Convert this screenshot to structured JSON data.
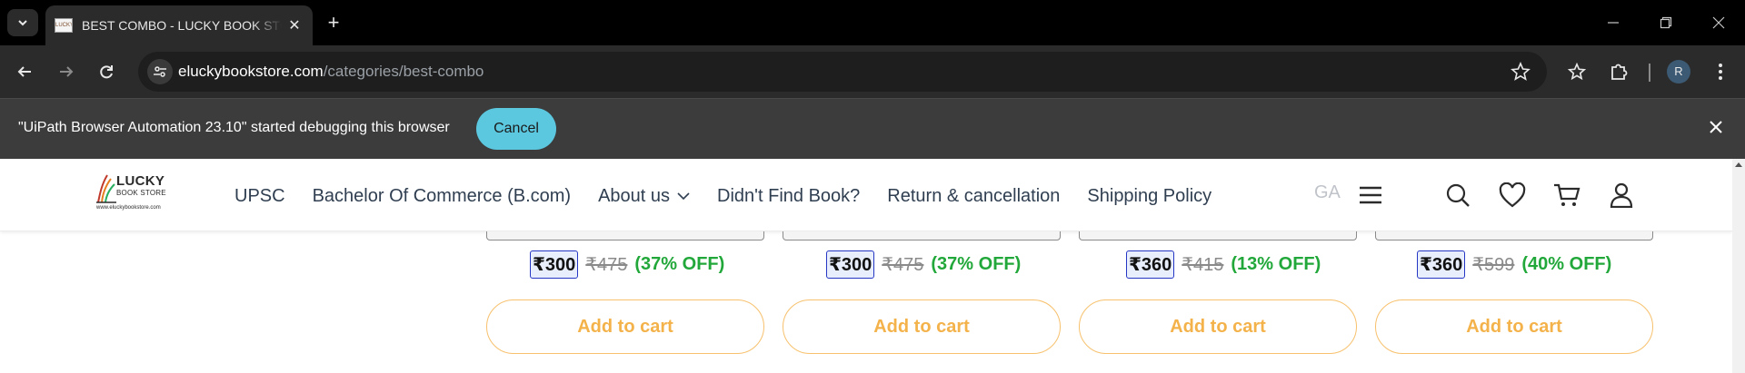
{
  "browser": {
    "tab": {
      "title": "BEST COMBO - LUCKY BOOK STORE",
      "favicon_text": "LUCKY",
      "close_glyph": "✕"
    },
    "new_tab_glyph": "+",
    "window_controls": {
      "minimize": "—",
      "restore": "❐",
      "close": "✕"
    },
    "address": {
      "host": "eluckybookstore.com",
      "path": "/categories/best-combo"
    },
    "profile_initial": "R"
  },
  "infobar": {
    "message": "\"UiPath Browser Automation 23.10\" started debugging this browser",
    "cancel_label": "Cancel",
    "close_glyph": "✕"
  },
  "site": {
    "logo": {
      "line1": "LUCKY",
      "line2": "BOOK STORE",
      "line3": "www.eluckybookstore.com"
    },
    "nav": [
      {
        "label": "UPSC"
      },
      {
        "label": "Bachelor Of Commerce (B.com)"
      },
      {
        "label": "About us"
      },
      {
        "label": "Didn't Find Book?"
      },
      {
        "label": "Return & cancellation"
      },
      {
        "label": "Shipping Policy"
      }
    ],
    "nav_overflow": "GA"
  },
  "products": [
    {
      "price": "₹300",
      "mrp": "₹475",
      "discount": "(37% OFF)",
      "add_label": "Add to cart"
    },
    {
      "price": "₹300",
      "mrp": "₹475",
      "discount": "(37% OFF)",
      "add_label": "Add to cart"
    },
    {
      "price": "₹360",
      "mrp": "₹415",
      "discount": "(13% OFF)",
      "add_label": "Add to cart"
    },
    {
      "price": "₹360",
      "mrp": "₹599",
      "discount": "(40% OFF)",
      "add_label": "Add to cart"
    }
  ],
  "colors": {
    "sale_border": "#2536c4",
    "discount": "#22a83a",
    "add_to_cart": "#f4b24a",
    "cancel_button": "#5bc8e0"
  }
}
